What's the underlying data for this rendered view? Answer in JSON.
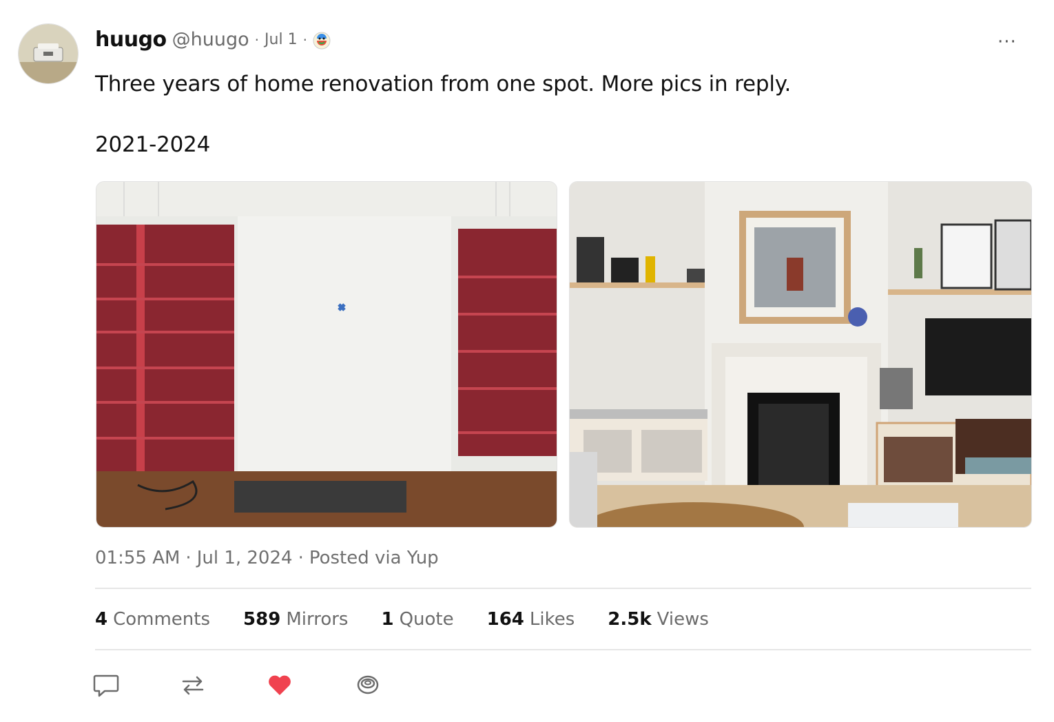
{
  "post": {
    "author_name": "huugo",
    "author_handle": "@huugo",
    "separator": "·",
    "relative_date": "Jul 1",
    "app_badge_icon": "yup-app-icon",
    "more_label": "···",
    "text_line1": "Three years of home renovation from one spot. More pics in reply.",
    "text_line2": "2021-2024",
    "images": [
      {
        "label": "before-photo",
        "description_icon": "photo-icon"
      },
      {
        "label": "after-photo",
        "description_icon": "photo-icon"
      }
    ],
    "time": "01:55 AM",
    "full_date": "Jul 1, 2024",
    "posted_via": "Posted via Yup"
  },
  "stats": {
    "comments": {
      "count": "4",
      "label": "Comments"
    },
    "mirrors": {
      "count": "589",
      "label": "Mirrors"
    },
    "quotes": {
      "count": "1",
      "label": "Quote"
    },
    "likes": {
      "count": "164",
      "label": "Likes"
    },
    "views": {
      "count": "2.5k",
      "label": "Views"
    }
  },
  "actions": {
    "comment_icon": "comment-icon",
    "mirror_icon": "repost-icon",
    "like_icon": "heart-icon",
    "collect_icon": "collect-icon",
    "like_color": "#f0424f"
  },
  "colors": {
    "text_primary": "#111111",
    "text_secondary": "#6b6b6b",
    "divider": "#e6e6e6"
  }
}
